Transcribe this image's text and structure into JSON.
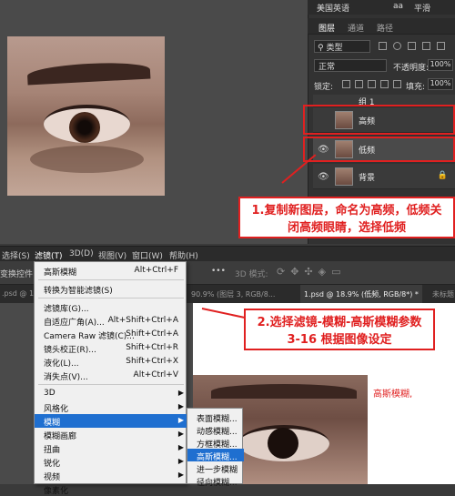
{
  "panel": {
    "language": "美国英语",
    "aa_icon": "aa",
    "smooth": "平滑",
    "tabs": [
      "图层",
      "通道",
      "路径"
    ],
    "search_kind": "类型",
    "blend_mode": "正常",
    "opacity_label": "不透明度:",
    "opacity_value": "100%",
    "lock_label": "锁定:",
    "fill_label": "填充:",
    "fill_value": "100%",
    "layers": [
      {
        "name": "组 1"
      },
      {
        "name": "高频"
      },
      {
        "name": "低频"
      },
      {
        "name": "背景"
      }
    ]
  },
  "callouts": {
    "step1": "1.复制新图层，命名为高频，低频关闭高频眼睛，选择低频",
    "step2": "2.选择滤镜-模糊-高斯模糊参数3-16 根据图像设定",
    "note": "高斯模糊,"
  },
  "menubar": {
    "items": [
      "选择(S)",
      "滤镜(T)",
      "3D(D)",
      "视图(V)",
      "窗口(W)",
      "帮助(H)"
    ]
  },
  "options_bar": {
    "left_label": "变换控件",
    "dots": "•••",
    "mode3d": "3D 模式:"
  },
  "doc_tabs": [
    ".psd @ 1",
    "90.9% (图层 3, RGB/8...",
    "1.psd @ 18.9% (低频, RGB/8*) *",
    "未标题"
  ],
  "filter_menu": {
    "items": [
      {
        "label": "高斯模糊",
        "shortcut": "Alt+Ctrl+F"
      },
      {
        "label": "转换为智能滤镜(S)",
        "shortcut": ""
      },
      {
        "label": "滤镜库(G)...",
        "shortcut": ""
      },
      {
        "label": "自适应广角(A)...",
        "shortcut": "Alt+Shift+Ctrl+A"
      },
      {
        "label": "Camera Raw 滤镜(C)...",
        "shortcut": "Shift+Ctrl+A"
      },
      {
        "label": "镜头校正(R)...",
        "shortcut": "Shift+Ctrl+R"
      },
      {
        "label": "液化(L)...",
        "shortcut": "Shift+Ctrl+X"
      },
      {
        "label": "消失点(V)...",
        "shortcut": "Alt+Ctrl+V"
      },
      {
        "label": "3D",
        "shortcut": ""
      },
      {
        "label": "风格化",
        "shortcut": ""
      },
      {
        "label": "模糊",
        "shortcut": ""
      },
      {
        "label": "模糊画廊",
        "shortcut": ""
      },
      {
        "label": "扭曲",
        "shortcut": ""
      },
      {
        "label": "锐化",
        "shortcut": ""
      },
      {
        "label": "视频",
        "shortcut": ""
      },
      {
        "label": "像素化",
        "shortcut": ""
      }
    ]
  },
  "blur_submenu": {
    "items": [
      "表面模糊...",
      "动感模糊...",
      "方框模糊...",
      "高斯模糊...",
      "进一步模糊",
      "径向模糊..."
    ]
  },
  "colors": {
    "accent_red": "#e02020",
    "highlight_blue": "#1f6fd0"
  }
}
